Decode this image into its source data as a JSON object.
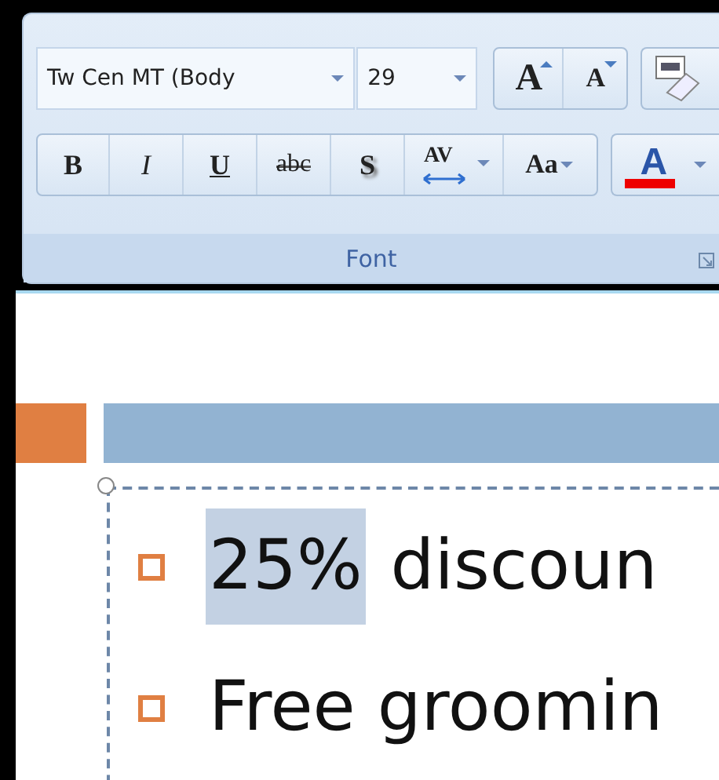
{
  "ribbon": {
    "font_name": "Tw Cen MT (Body",
    "font_size": "29",
    "grow_button": "A",
    "shrink_button": "A",
    "format_buttons": [
      {
        "kind": "bold",
        "label": "B"
      },
      {
        "kind": "italic",
        "label": "I"
      },
      {
        "kind": "underline",
        "label": "U"
      },
      {
        "kind": "strike",
        "label": "abc"
      },
      {
        "kind": "shadow",
        "label": "S"
      },
      {
        "kind": "spacing",
        "label": "AV"
      },
      {
        "kind": "case",
        "label": "Aa"
      }
    ],
    "font_color_button": {
      "label": "A",
      "color": "#ee0000"
    },
    "group_label": "Font"
  },
  "slide": {
    "bullets": [
      {
        "parts": [
          {
            "text": "25%",
            "selected": true
          },
          {
            "text": "discoun",
            "selected": false
          }
        ]
      },
      {
        "parts": [
          {
            "text": "Free groomin",
            "selected": false
          }
        ]
      }
    ]
  }
}
